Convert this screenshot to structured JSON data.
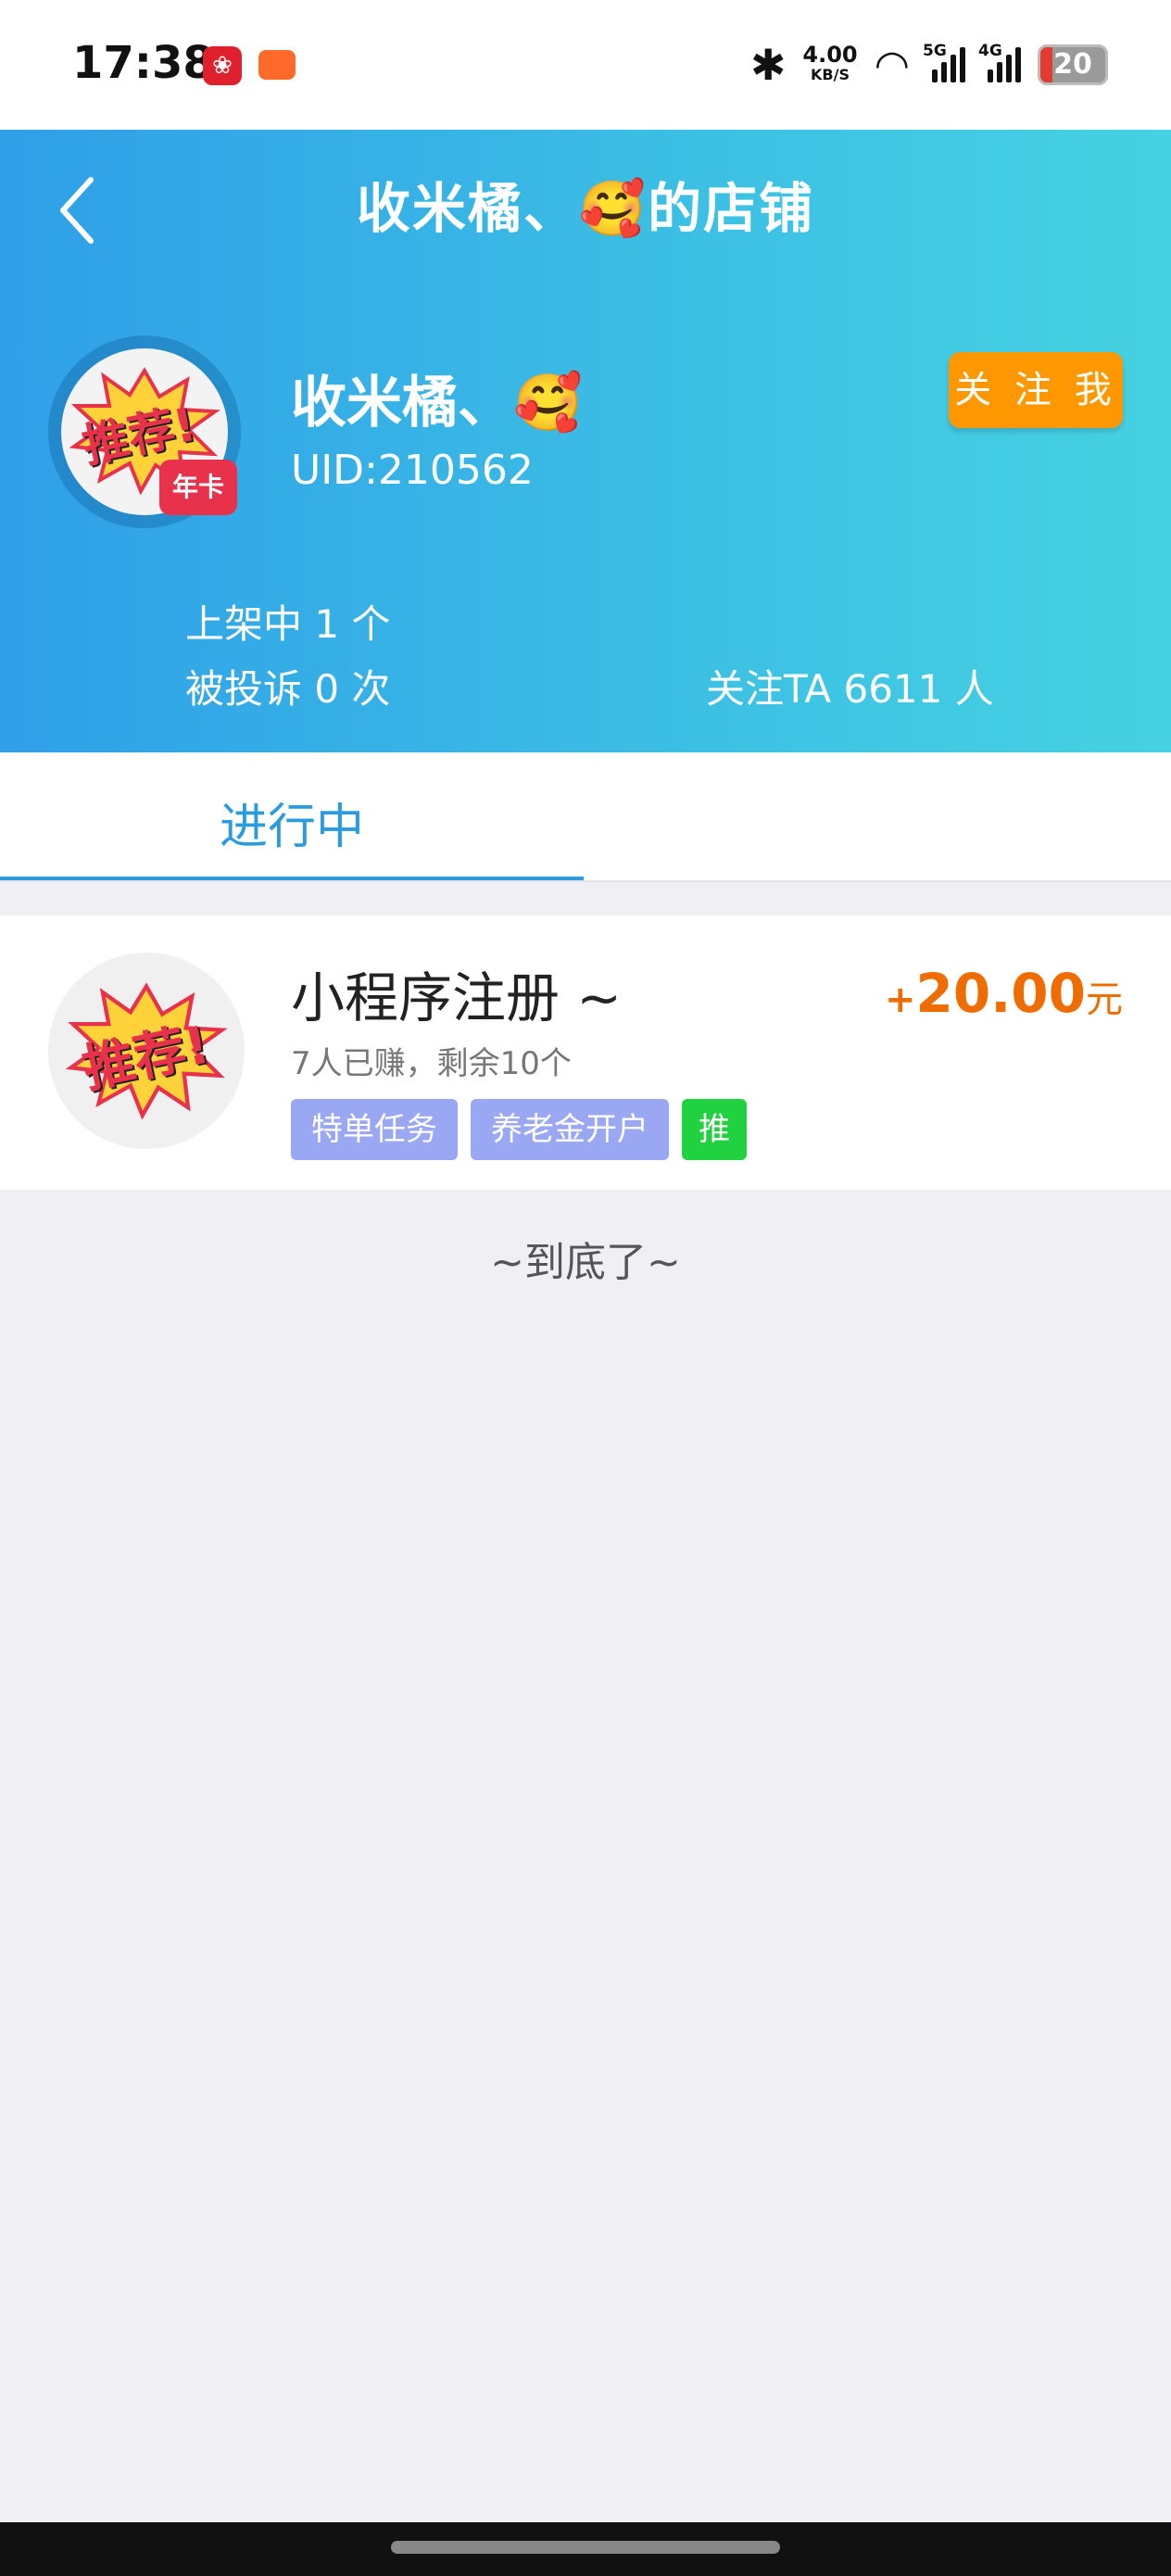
{
  "status_bar": {
    "time": "17:38",
    "speed_value": "4.00",
    "speed_unit": "KB/S",
    "sim1_label": "5G",
    "sim2_label": "4G",
    "battery": "20"
  },
  "header": {
    "title": "收米橘、🥰的店铺",
    "back_icon": "chevron-left-icon"
  },
  "profile": {
    "name": "收米橘、🥰",
    "uid": "UID:210562",
    "follow_label": "关 注 我",
    "avatar_text": "推荐!",
    "badge_text": "年卡",
    "listed": "上架中 1 个",
    "complaints": "被投诉 0 次",
    "followers": "关注TA 6611 人"
  },
  "tabs": [
    {
      "label": "进行中",
      "active": true
    }
  ],
  "tasks": [
    {
      "thumb_text": "推荐!",
      "title": "小程序注册 ~",
      "reward_sign": "+",
      "reward_amount": "20.00",
      "reward_unit": "元",
      "meta": "7人已赚，剩余10个",
      "tags": [
        "特单任务",
        "养老金开户",
        "推"
      ]
    }
  ],
  "end_text": "~到底了~",
  "colors": {
    "accent": "#2b9be0",
    "follow": "#ff9800",
    "reward": "#ef6c00",
    "tag_blue": "#9aa8f4",
    "tag_green": "#20d23f"
  }
}
